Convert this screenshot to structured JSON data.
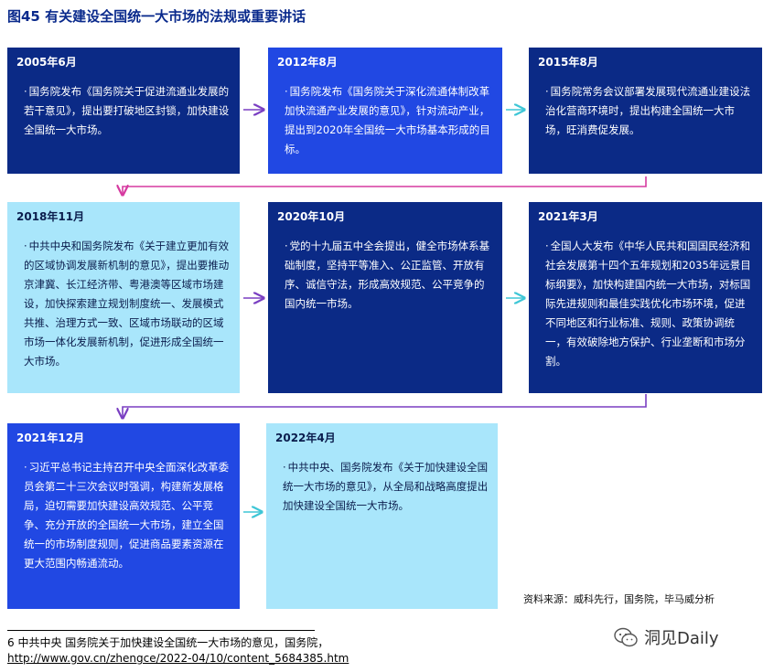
{
  "title": "图45 有关建设全国统一大市场的法规或重要讲话",
  "events": [
    {
      "date": "2005年6月",
      "text": "国务院发布《国务院关于促进流通业发展的若干意见》，提出要打破地区封锁，加快建设全国统一大市场。"
    },
    {
      "date": "2012年8月",
      "text": "国务院发布《国务院关于深化流通体制改革加快流通产业发展的意见》，针对流动产业，提出到2020年全国统一大市场基本形成的目标。"
    },
    {
      "date": "2015年8月",
      "text": "国务院常务会议部署发展现代流通业建设法治化营商环境时，提出构建全国统一大市场，旺消费促发展。"
    },
    {
      "date": "2018年11月",
      "text": "中共中央和国务院发布《关于建立更加有效的区域协调发展新机制的意见》，提出要推动京津冀、长江经济带、粤港澳等区域市场建设，加快探索建立规划制度统一、发展模式共推、治理方式一致、区域市场联动的区域市场一体化发展新机制，促进形成全国统一大市场。"
    },
    {
      "date": "2020年10月",
      "text": "党的十九届五中全会提出，健全市场体系基础制度，坚持平等准入、公正监管、开放有序、诚信守法，形成高效规范、公平竞争的国内统一市场。"
    },
    {
      "date": "2021年3月",
      "text": "全国人大发布《中华人民共和国国民经济和社会发展第十四个五年规划和2035年远景目标纲要》，加快构建国内统一大市场，对标国际先进规则和最佳实践优化市场环境，促进不同地区和行业标准、规则、政策协调统一，有效破除地方保护、行业垄断和市场分割。"
    },
    {
      "date": "2021年12月",
      "text": "习近平总书记主持召开中央全面深化改革委员会第二十三次会议时强调，构建新发展格局，迫切需要加快建设高效规范、公平竞争、充分开放的全国统一大市场，建立全国统一的市场制度规则，促进商品要素资源在更大范围内畅通流动。"
    },
    {
      "date": "2022年4月",
      "text": "中共中央、国务院发布《关于加快建设全国统一大市场的意见》，从全局和战略高度提出加快建设全国统一大市场。"
    }
  ],
  "source": "资料来源：威科先行，国务院，毕马威分析",
  "footnote": {
    "text": "6 中共中央 国务院关于加快建设全国统一大市场的意见，国务院，",
    "url": "http://www.gov.cn/zhengce/2022-04/10/content_5684385.htm"
  },
  "watermark": {
    "text": "洞见Daily",
    "icon": "wechat-icon"
  },
  "colors": {
    "navy": "#0b2a86",
    "blue": "#2148e3",
    "light": "#a9e6fb",
    "arrow_purple": "#7a3fc2",
    "arrow_teal": "#3ec6d6",
    "arrow_pink": "#d63aa0"
  }
}
